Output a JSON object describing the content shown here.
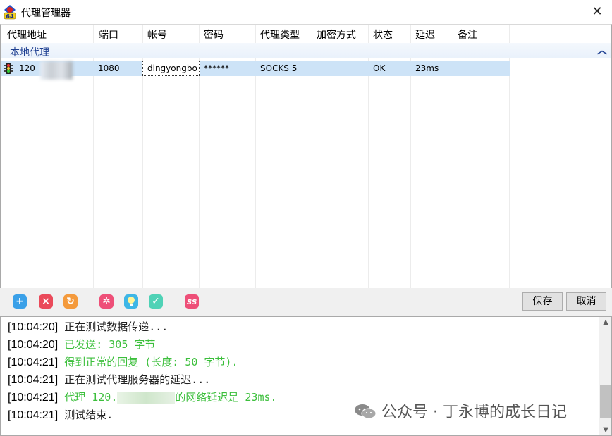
{
  "window": {
    "title": "代理管理器"
  },
  "columns": [
    "代理地址",
    "端口",
    "帐号",
    "密码",
    "代理类型",
    "加密方式",
    "状态",
    "延迟",
    "备注"
  ],
  "group": {
    "label": "本地代理"
  },
  "rows": [
    {
      "address": "120",
      "port": "1080",
      "account": "dingyongbo",
      "password": "******",
      "type": "SOCKS 5",
      "encryption": "",
      "status": "OK",
      "delay": "23ms",
      "note": ""
    }
  ],
  "toolbar": {
    "icons": [
      "add-icon",
      "delete-icon",
      "refresh-icon",
      "settings-icon",
      "bulb-icon",
      "check-icon",
      "ss-icon"
    ],
    "ss_label": "ss",
    "save_label": "保存",
    "cancel_label": "取消"
  },
  "log": [
    {
      "time": "[10:04:20]",
      "msg": "正在测试数据传递...",
      "color": "black"
    },
    {
      "time": "[10:04:20]",
      "msg": "已发送: 305 字节",
      "color": "green"
    },
    {
      "time": "[10:04:21]",
      "msg": "得到正常的回复 (长度: 50 字节).",
      "color": "green"
    },
    {
      "time": "[10:04:21]",
      "msg": "正在测试代理服务器的延迟...",
      "color": "black"
    },
    {
      "time": "[10:04:21]",
      "msg_pre": "代理 120.",
      "msg_post": "的网络延迟是 23ms.",
      "color": "green"
    },
    {
      "time": "[10:04:21]",
      "msg": "测试结束.",
      "color": "black"
    }
  ],
  "watermark": {
    "text": "公众号 · 丁永博的成长日记"
  },
  "colors": {
    "selected_row": "#cde3f7",
    "group_text": "#1e3f91",
    "log_green": "#3cbf3c"
  }
}
